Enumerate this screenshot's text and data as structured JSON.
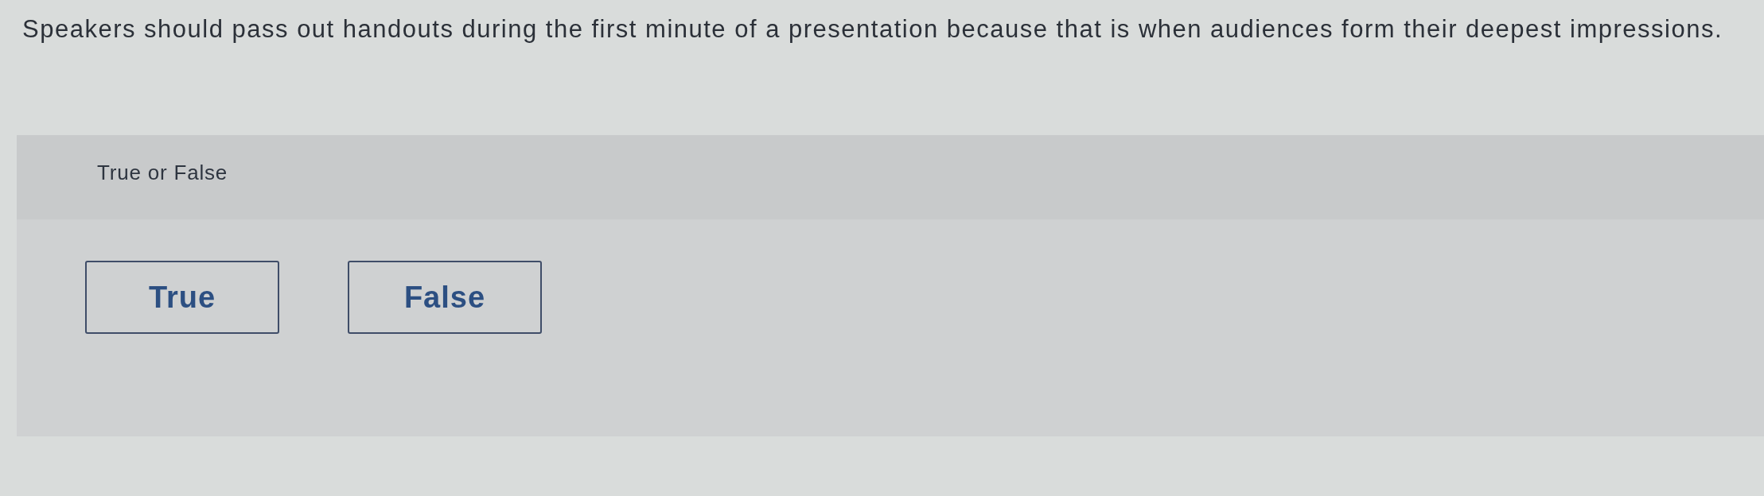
{
  "question": {
    "text": "Speakers should pass out handouts during the first minute of a presentation because that is when audiences form their deepest impressions."
  },
  "answer_panel": {
    "prompt": "True or False",
    "options": [
      {
        "label": "True",
        "selected": false
      },
      {
        "label": "False",
        "selected": false
      }
    ]
  }
}
